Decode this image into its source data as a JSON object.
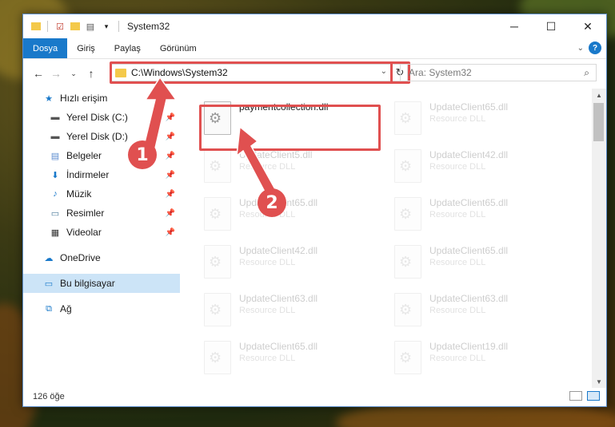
{
  "window": {
    "title": "System32"
  },
  "ribbon": {
    "tabs": [
      "Dosya",
      "Giriş",
      "Paylaş",
      "Görünüm"
    ]
  },
  "address_bar": {
    "path": "C:\\Windows\\System32"
  },
  "search": {
    "placeholder": "Ara: System32"
  },
  "sidebar": {
    "quick_access": "Hızlı erişim",
    "items": [
      "Yerel Disk (C:)",
      "Yerel Disk (D:)",
      "Belgeler",
      "İndirmeler",
      "Müzik",
      "Resimler",
      "Videolar"
    ],
    "onedrive": "OneDrive",
    "this_pc": "Bu bilgisayar",
    "network": "Ağ"
  },
  "files": [
    {
      "name": "paymentcollection.dll",
      "type": ""
    },
    {
      "name": "UpdateClient65.dll",
      "type": "Resource DLL"
    },
    {
      "name": "UpdateClient5.dll",
      "type": "Resource DLL"
    },
    {
      "name": "UpdateClient42.dll",
      "type": "Resource DLL"
    },
    {
      "name": "UpdateClient65.dll",
      "type": "Resource DLL"
    },
    {
      "name": "UpdateClient65.dll",
      "type": "Resource DLL"
    },
    {
      "name": "UpdateClient42.dll",
      "type": "Resource DLL"
    },
    {
      "name": "UpdateClient65.dll",
      "type": "Resource DLL"
    },
    {
      "name": "UpdateClient63.dll",
      "type": "Resource DLL"
    },
    {
      "name": "UpdateClient63.dll",
      "type": "Resource DLL"
    },
    {
      "name": "UpdateClient65.dll",
      "type": "Resource DLL"
    },
    {
      "name": "UpdateClient19.dll",
      "type": "Resource DLL"
    }
  ],
  "status": {
    "count": "126 öğe"
  },
  "annotations": {
    "step1": "1",
    "step2": "2"
  },
  "colors": {
    "accent": "#1979ca",
    "highlight": "#e05050",
    "selection": "#cce4f7"
  }
}
